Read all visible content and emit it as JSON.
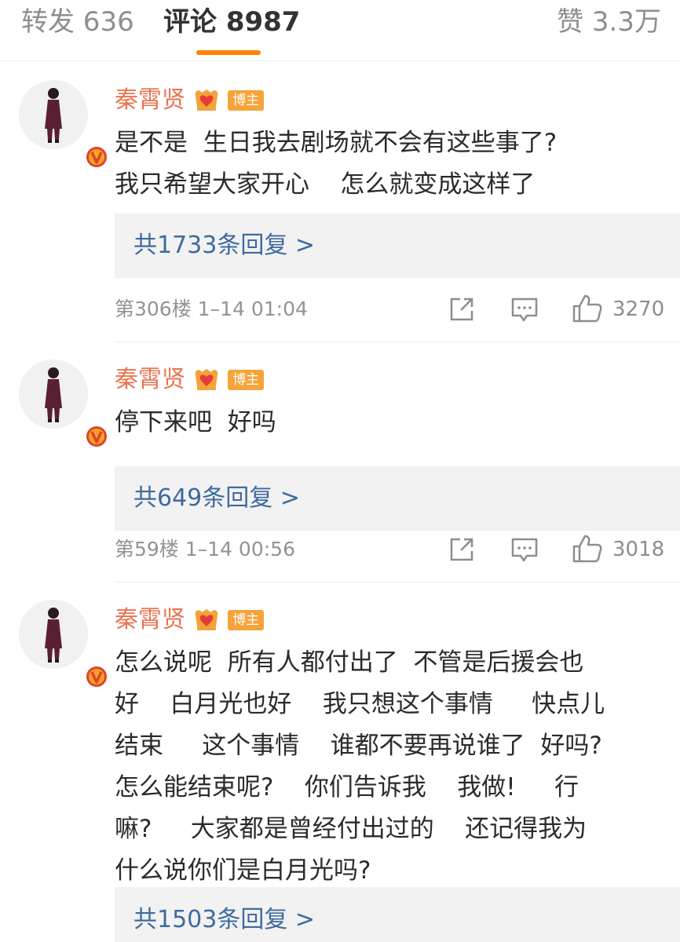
{
  "tabs": {
    "reposts": "转发 636",
    "comments": "评论 8987",
    "likes": "赞 3.3万"
  },
  "colors": {
    "accent": "#ff8200",
    "username": "#eb7350",
    "link": "#3e6b9e",
    "verified": "#e2412e",
    "op_badge": "#f6a33a"
  },
  "comments": [
    {
      "username": "秦霄贤",
      "badge": "博主",
      "text": "是不是  生日我去剧场就不会有这些事了?\n我只希望大家开心    怎么就变成这样了",
      "replies": "共1733条回复 >",
      "meta": "第306楼  1–14 01:04",
      "likes": "3270"
    },
    {
      "username": "秦霄贤",
      "badge": "博主",
      "text": "停下来吧  好吗",
      "replies": "共649条回复 >",
      "meta": "第59楼  1–14 00:56",
      "likes": "3018"
    },
    {
      "username": "秦霄贤",
      "badge": "博主",
      "text": "怎么说呢  所有人都付出了  不管是后援会也\n好    白月光也好    我只想这个事情     快点儿\n结束     这个事情    谁都不要再说谁了  好吗?\n怎么能结束呢?    你们告诉我    我做!     行\n嘛?     大家都是曾经付出过的    还记得我为\n什么说你们是白月光吗?",
      "replies": "共1503条回复 >"
    }
  ],
  "icons": [
    "crown-icon",
    "verified-icon",
    "share-icon",
    "reply-icon",
    "like-icon"
  ]
}
